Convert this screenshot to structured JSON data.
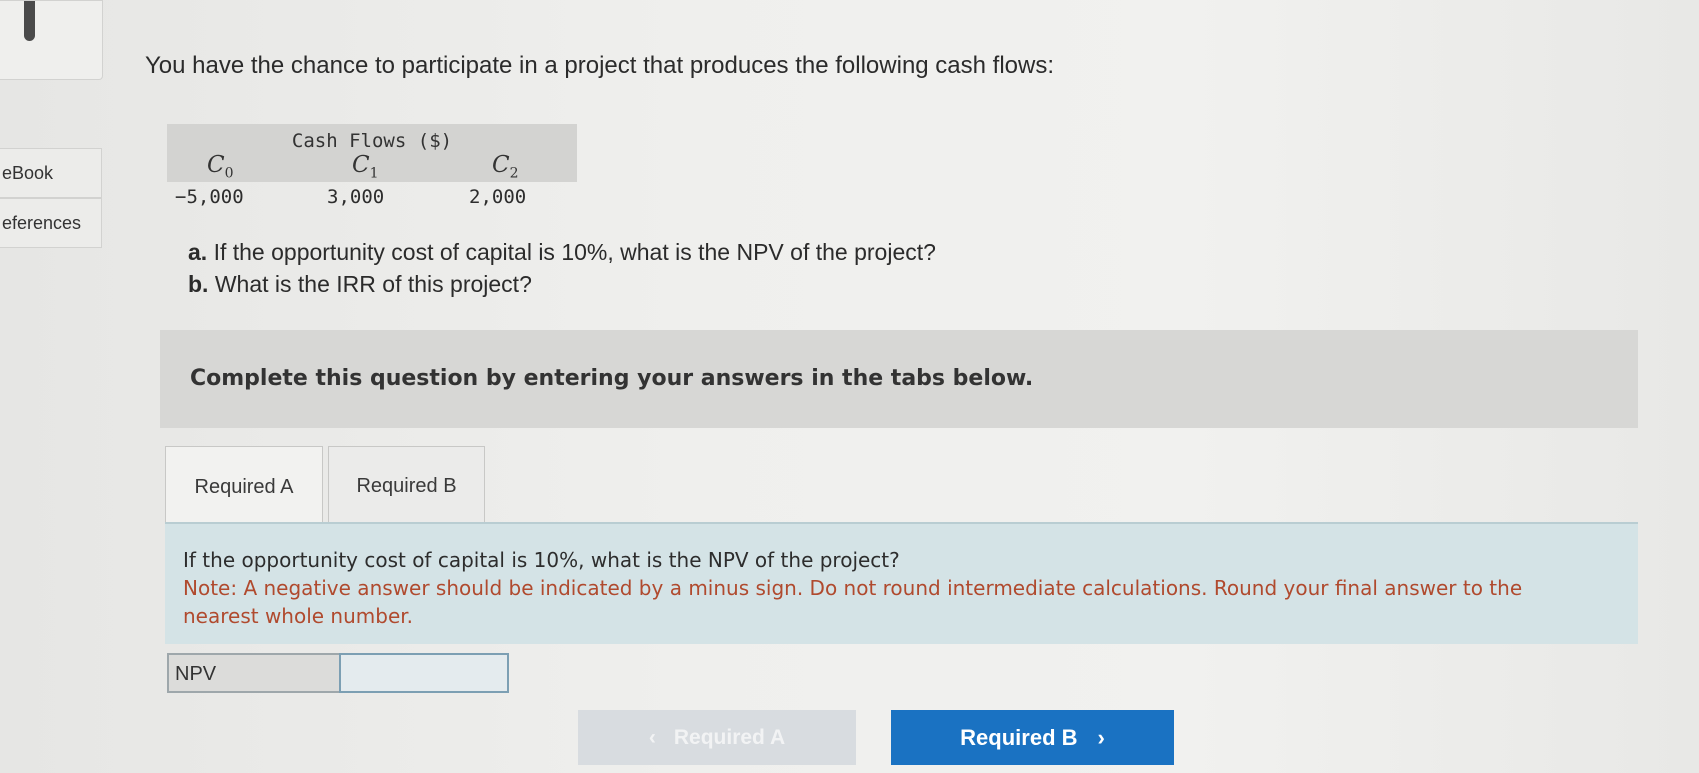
{
  "sidebar": {
    "items": [
      {
        "label": "eBook"
      },
      {
        "label": "eferences"
      }
    ]
  },
  "question": "You have the chance to participate in a project that produces the following cash flows:",
  "cash_flow_table": {
    "title": "Cash Flows ($)",
    "columns": [
      {
        "symbol": "C0",
        "value": "−5,000"
      },
      {
        "symbol": "C1",
        "value": "3,000"
      },
      {
        "symbol": "C2",
        "value": "2,000"
      }
    ]
  },
  "parts": {
    "a_marker": "a.",
    "a_text": "If the opportunity cost of capital is 10%, what is the NPV of the project?",
    "b_marker": "b.",
    "b_text": "What is the IRR of this project?"
  },
  "instructions": "Complete this question by entering your answers in the tabs below.",
  "tabs": [
    {
      "label": "Required A",
      "active": true
    },
    {
      "label": "Required B",
      "active": false
    }
  ],
  "answer_panel": {
    "question": "If the opportunity cost of capital is 10%, what is the NPV of the project?",
    "note": "Note: A negative answer should be indicated by a minus sign. Do not round intermediate calculations. Round your final answer to the nearest whole number."
  },
  "npv_field": {
    "label": "NPV",
    "value": ""
  },
  "nav": {
    "prev_label": "Required A",
    "prev_icon": "chevron-left-icon",
    "next_label": "Required B",
    "next_icon": "chevron-right-icon"
  },
  "colors": {
    "accent": "#1a72c2",
    "note_text": "#b04a2e",
    "answer_panel_bg": "#d4e3e6"
  }
}
